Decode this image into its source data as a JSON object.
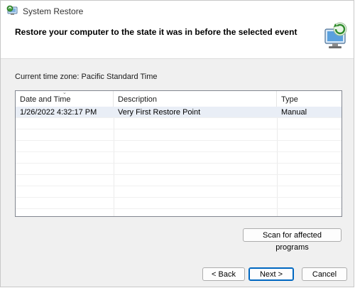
{
  "window": {
    "title": "System Restore"
  },
  "header": {
    "title": "Restore your computer to the state it was in before the selected event"
  },
  "timezone": {
    "label": "Current time zone: Pacific Standard Time"
  },
  "table": {
    "columns": [
      "Date and Time",
      "Description",
      "Type"
    ],
    "sort_column": "Date and Time",
    "rows": [
      {
        "date": "1/26/2022 4:32:17 PM",
        "description": "Very First Restore Point",
        "type": "Manual"
      }
    ]
  },
  "buttons": {
    "scan": "Scan for affected programs",
    "back": "< Back",
    "next": "Next >",
    "cancel": "Cancel"
  },
  "icons": {
    "title": "system-restore-icon",
    "header": "restore-computer-graphic",
    "sort": "sort-arrow-icon"
  },
  "colors": {
    "header_bg": "#ffffff",
    "body_bg": "#f0f0f0",
    "selected_row": "#e9eef6",
    "primary_border": "#0067c0"
  }
}
